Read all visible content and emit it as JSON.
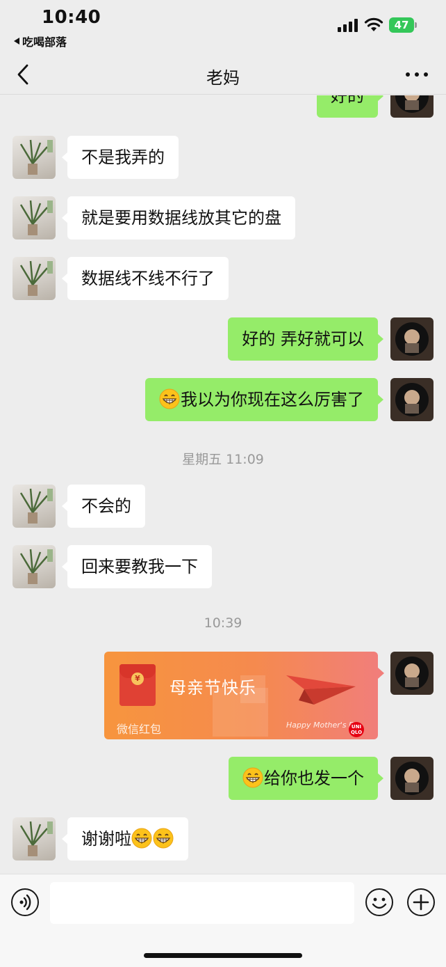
{
  "status_bar": {
    "time": "10:40",
    "back_app": "吃喝部落",
    "battery": "47",
    "battery_color": "#34c759"
  },
  "nav": {
    "title": "老妈",
    "back_icon": "chevron-left-icon",
    "more_icon": "more-dots-icon"
  },
  "messages": [
    {
      "type": "text",
      "side": "out",
      "text": "好的"
    },
    {
      "type": "text",
      "side": "in",
      "text": "不是我弄的"
    },
    {
      "type": "text",
      "side": "in",
      "text": "就是要用数据线放其它的盘"
    },
    {
      "type": "text",
      "side": "in",
      "text": "数据线不线不行了"
    },
    {
      "type": "text",
      "side": "out",
      "text": "好的 弄好就可以"
    },
    {
      "type": "text",
      "side": "out",
      "emoji_prefix": 1,
      "text": "我以为你现在这么厉害了"
    },
    {
      "type": "time",
      "text": "星期五 11:09"
    },
    {
      "type": "text",
      "side": "in",
      "text": "不会的"
    },
    {
      "type": "text",
      "side": "in",
      "text": "回来要教我一下"
    },
    {
      "type": "time",
      "text": "10:39"
    },
    {
      "type": "red_packet",
      "side": "out",
      "title": "母亲节快乐",
      "label": "微信红包",
      "brand_text": "Happy Mother's Day",
      "logo_text": "UNI QLO"
    },
    {
      "type": "text",
      "side": "out",
      "emoji_prefix": 1,
      "text": "给你也发一个"
    },
    {
      "type": "text",
      "side": "in",
      "text": "谢谢啦",
      "emoji_suffix": 2
    }
  ],
  "input_bar": {
    "placeholder": "",
    "voice_icon": "voice-icon",
    "emoji_icon": "emoji-icon",
    "plus_icon": "plus-icon"
  },
  "colors": {
    "incoming_bubble": "#ffffff",
    "outgoing_bubble": "#95ec69",
    "background": "#ededed",
    "red_packet": "#f7953e"
  }
}
